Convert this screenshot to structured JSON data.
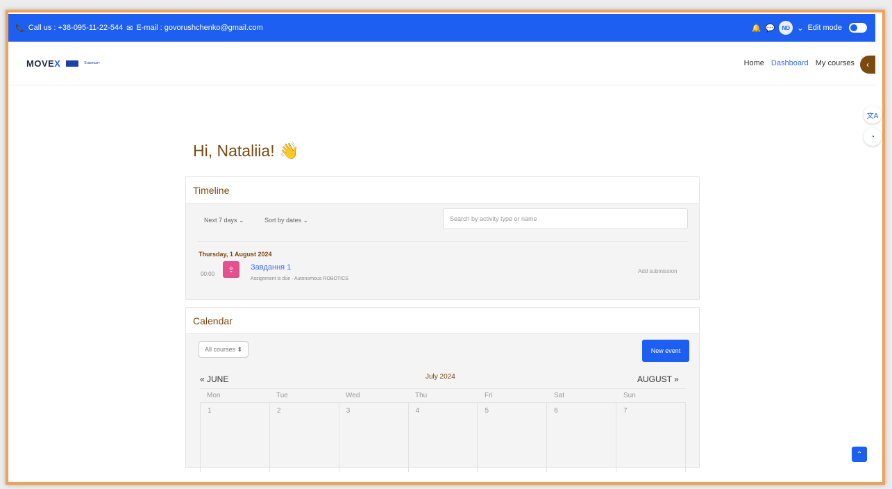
{
  "topbar": {
    "phone": "Call us : +38-095-11-22-544",
    "email": "E-mail : govorushchenko@gmail.com",
    "avatar": "ND",
    "edit_mode": "Edit mode"
  },
  "navbar": {
    "logo_main": "MOVE",
    "logo_accent": "X",
    "eu_label": "Erasmus+",
    "links": [
      "Home",
      "Dashboard",
      "My courses"
    ]
  },
  "greeting": "Hi, Nataliia! 👋",
  "timeline": {
    "title": "Timeline",
    "filter_days": "Next 7 days ⌄",
    "filter_sort": "Sort by dates ⌄",
    "search_placeholder": "Search by activity type or name",
    "date": "Thursday, 1 August 2024",
    "time": "00:00",
    "item_title": "Завдання 1",
    "item_sub": "Assignment is due · Autonomous ROBOTICS",
    "action": "Add submission"
  },
  "calendar": {
    "title": "Calendar",
    "course_select": "All courses ⬍",
    "new_event": "New event",
    "prev": "« JUNE",
    "month": "July 2024",
    "next": "AUGUST »",
    "days": [
      "Mon",
      "Tue",
      "Wed",
      "Thu",
      "Fri",
      "Sat",
      "Sun"
    ],
    "week1": [
      "1",
      "2",
      "3",
      "4",
      "5",
      "6",
      "7"
    ]
  },
  "colors": {
    "brand_blue": "#1d5ff0",
    "accent_brown": "#7a4a0f",
    "frame_orange": "#f0a25c"
  }
}
